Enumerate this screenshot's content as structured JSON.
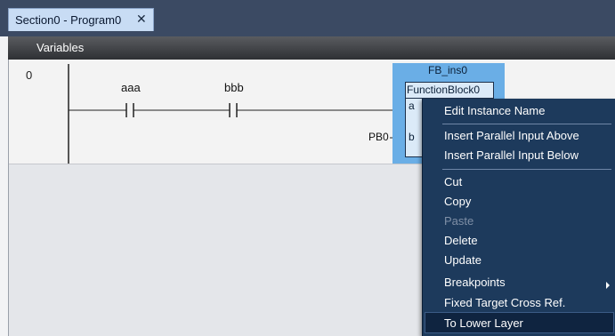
{
  "tab": {
    "title": "Section0 - Program0",
    "close_glyph": "✕"
  },
  "toolbar": {
    "variables_label": "Variables"
  },
  "rung": {
    "number": "0"
  },
  "contacts": [
    {
      "name": "aaa"
    },
    {
      "name": "bbb"
    }
  ],
  "function_block": {
    "instance": "FB_ins0",
    "type": "FunctionBlock0",
    "inputs": [
      {
        "pin": "a"
      },
      {
        "pin": "b",
        "variable": "PB0"
      }
    ]
  },
  "context_menu": {
    "items": [
      {
        "label": "Edit Instance Name"
      },
      {
        "label": "Insert Parallel Input Above"
      },
      {
        "label": "Insert Parallel Input Below"
      },
      {
        "label": "Cut"
      },
      {
        "label": "Copy"
      },
      {
        "label": "Paste",
        "disabled": true
      },
      {
        "label": "Delete"
      },
      {
        "label": "Update"
      },
      {
        "label": "Breakpoints",
        "submenu": true
      },
      {
        "label": "Fixed Target Cross Ref."
      },
      {
        "label": "To Lower Layer",
        "highlighted": true
      }
    ]
  },
  "colors": {
    "title_bar": "#3b4a63",
    "tab": "#c8dcf4",
    "fb_selection": "#6aaee6",
    "menu_bg": "#1d3a5c"
  }
}
